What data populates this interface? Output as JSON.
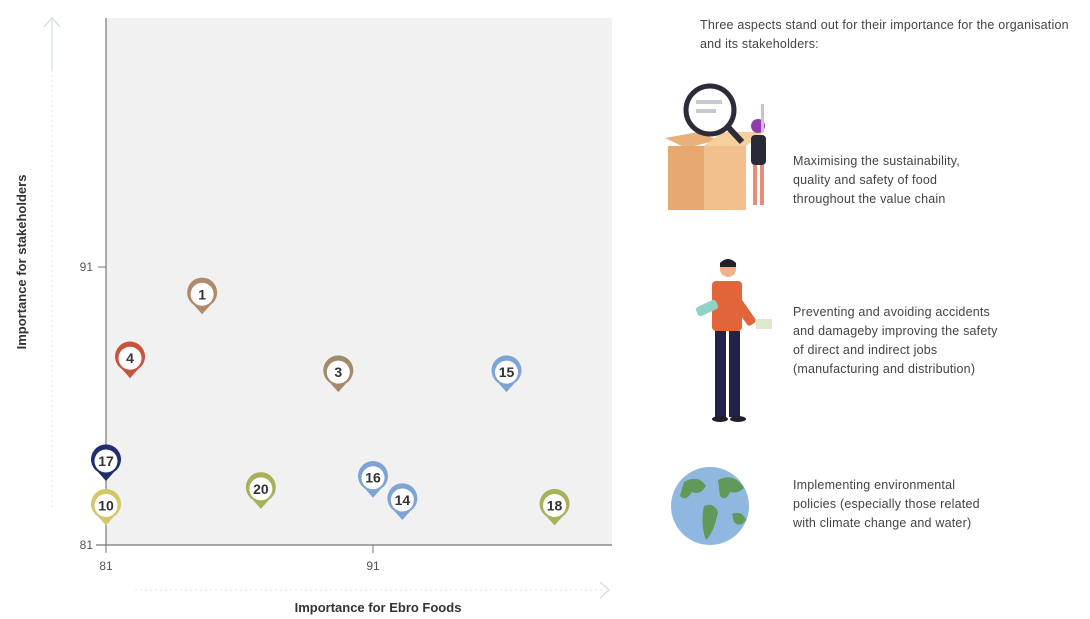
{
  "chart_data": {
    "type": "scatter",
    "xlabel": "Importance for Ebro Foods",
    "ylabel": "Importance for stakeholders",
    "xlim": [
      81,
      97.8
    ],
    "ylim": [
      81,
      91
    ],
    "x_ticks": [
      "81",
      "91"
    ],
    "y_ticks": [
      "81",
      "91"
    ],
    "grid": false,
    "points": [
      {
        "label": "1",
        "x": 84.6,
        "y": 89.3,
        "color": "#b08a6a"
      },
      {
        "label": "4",
        "x": 81.9,
        "y": 87.0,
        "color": "#c9533f"
      },
      {
        "label": "3",
        "x": 89.7,
        "y": 86.5,
        "color": "#a48a6c"
      },
      {
        "label": "15",
        "x": 96.0,
        "y": 86.5,
        "color": "#7ea4d6"
      },
      {
        "label": "17",
        "x": 81.0,
        "y": 83.3,
        "color": "#1f2f6e"
      },
      {
        "label": "10",
        "x": 81.0,
        "y": 81.7,
        "color": "#d4c76a"
      },
      {
        "label": "20",
        "x": 86.8,
        "y": 82.3,
        "color": "#a8b05a"
      },
      {
        "label": "16",
        "x": 91.0,
        "y": 82.7,
        "color": "#7ea4d6"
      },
      {
        "label": "14",
        "x": 92.1,
        "y": 81.9,
        "color": "#7ea4d6"
      },
      {
        "label": "18",
        "x": 97.8,
        "y": 81.7,
        "color": "#a8b05a"
      }
    ]
  },
  "panel": {
    "intro": "Three aspects stand out for their importance for the organisation and its stakeholders:",
    "aspects": [
      {
        "icon": "box-magnifier-illustration",
        "text": "Maximising the sustainability,\nquality and safety of food\nthroughout the value chain"
      },
      {
        "icon": "worker-illustration",
        "text": "Preventing and avoiding accidents\nand damageby improving the safety\nof direct and indirect jobs\n(manufacturing and distribution)"
      },
      {
        "icon": "globe-icon",
        "text": "Implementing environmental\npolicies (especially those related\nwith climate change and water)"
      }
    ]
  }
}
